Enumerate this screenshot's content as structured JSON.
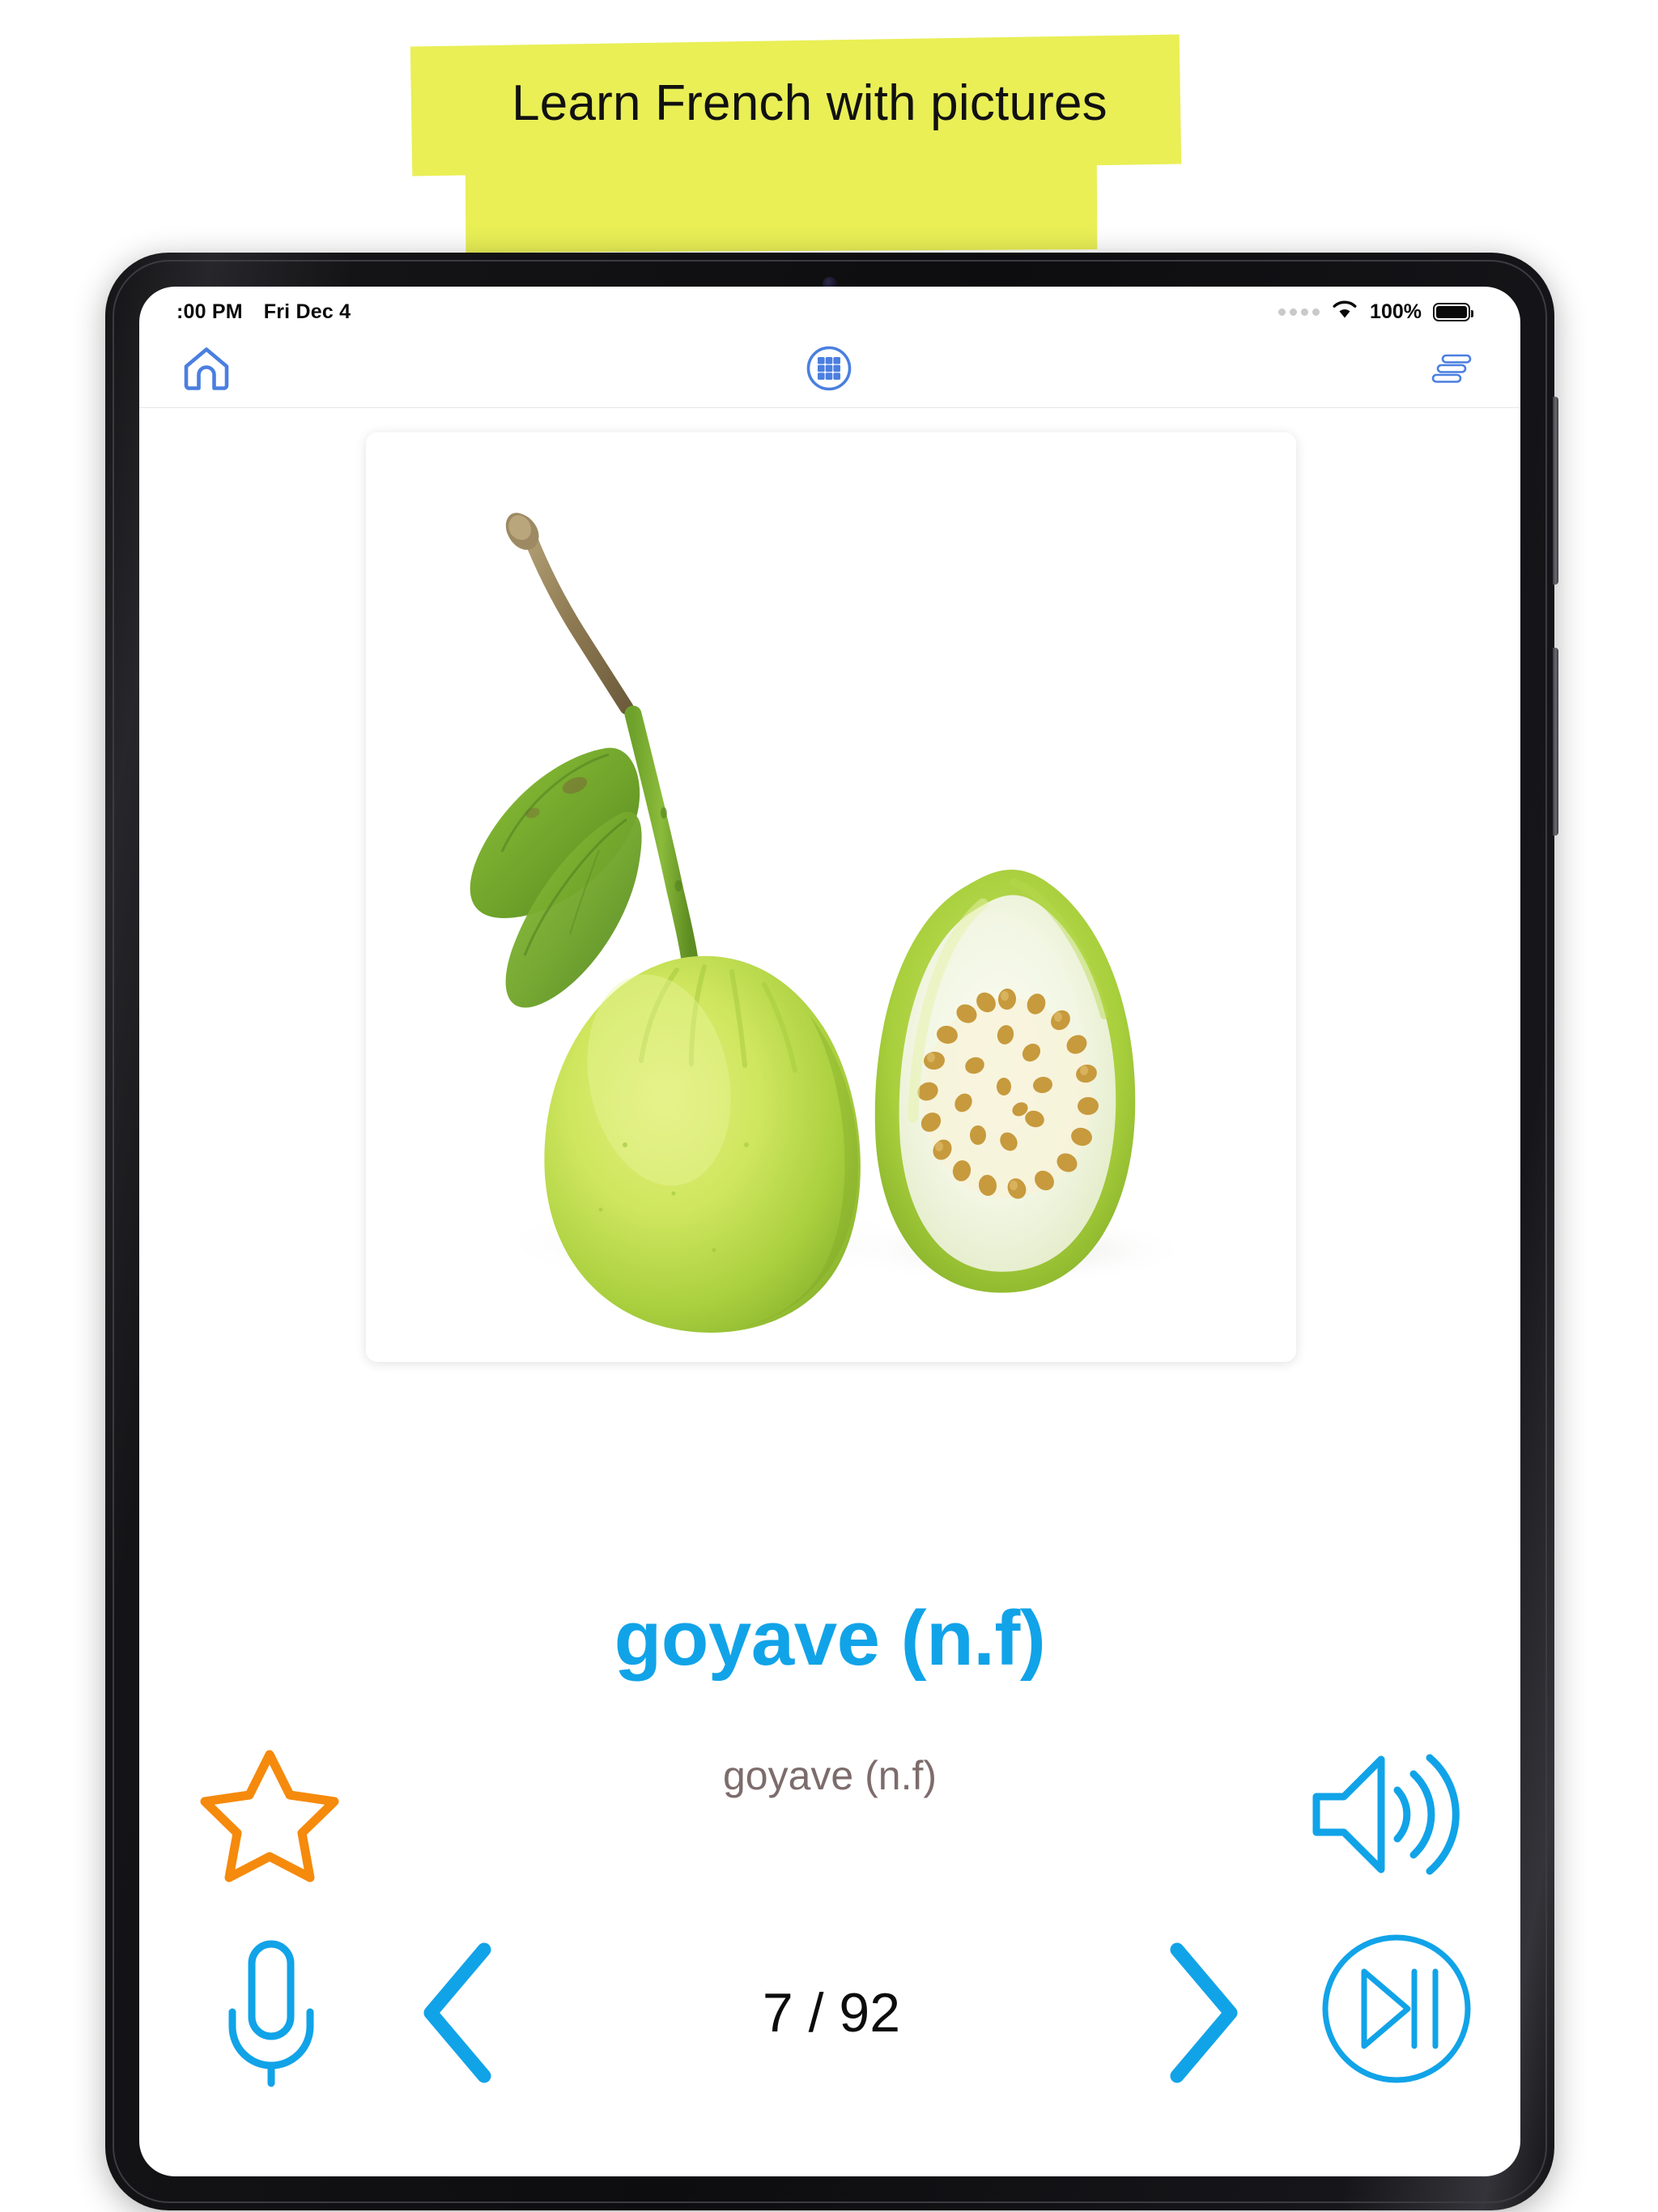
{
  "promo": {
    "headline": "Learn French with pictures",
    "banner_color": "#e9ef55"
  },
  "device": {
    "type": "tablet",
    "bezel_color": "#141416"
  },
  "status_bar": {
    "time": ":00 PM",
    "date": "Fri Dec 4",
    "battery_percent": "100%",
    "wifi_icon": "wifi-icon",
    "battery_icon": "battery-full-icon",
    "signal_icon": "signal-dots-icon"
  },
  "toolbar": {
    "home_icon": "home-icon",
    "grid_icon": "grid-circle-icon",
    "list_icon": "staggered-list-icon",
    "icon_color": "#4a7fe0"
  },
  "card": {
    "image_alt": "guava fruit whole and halved on white background",
    "word_main": "goyave (n.f)",
    "word_sub": "goyave (n.f)",
    "word_main_color": "#11a3e8",
    "word_sub_color": "#7d6c6c"
  },
  "controls": {
    "favorite_icon": "star-outline-icon",
    "favorite_color": "#f58a0c",
    "speaker_icon": "speaker-waves-icon",
    "mic_icon": "microphone-icon",
    "prev_icon": "chevron-left-icon",
    "next_icon": "chevron-right-icon",
    "autoplay_icon": "skip-next-circle-icon",
    "accent_color": "#11a3e8",
    "counter": "7 / 92",
    "current_index": 7,
    "total_count": 92
  }
}
